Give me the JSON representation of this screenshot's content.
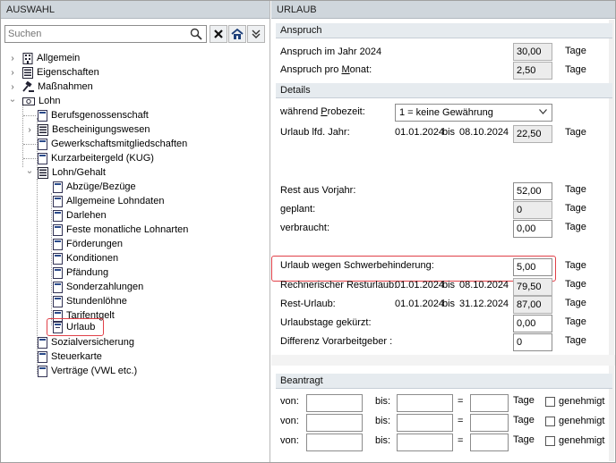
{
  "left": {
    "header": "AUSWAHL",
    "search_placeholder": "Suchen",
    "tree": [
      {
        "label": "Allgemein"
      },
      {
        "label": "Eigenschaften"
      },
      {
        "label": "Maßnahmen"
      },
      {
        "label": "Lohn"
      },
      {
        "label": "Berufsgenossenschaft"
      },
      {
        "label": "Bescheinigungswesen"
      },
      {
        "label": "Gewerkschaftsmitgliedschaften"
      },
      {
        "label": "Kurzarbeitergeld (KUG)"
      },
      {
        "label": "Lohn/Gehalt"
      },
      {
        "label": "Abzüge/Bezüge"
      },
      {
        "label": "Allgemeine Lohndaten"
      },
      {
        "label": "Darlehen"
      },
      {
        "label": "Feste monatliche Lohnarten"
      },
      {
        "label": "Förderungen"
      },
      {
        "label": "Konditionen"
      },
      {
        "label": "Pfändung"
      },
      {
        "label": "Sonderzahlungen"
      },
      {
        "label": "Stundenlöhne"
      },
      {
        "label": "Tarifentgelt"
      },
      {
        "label": "Urlaub"
      },
      {
        "label": "Sozialversicherung"
      },
      {
        "label": "Steuerkarte"
      },
      {
        "label": "Verträge (VWL etc.)"
      }
    ]
  },
  "right": {
    "header": "URLAUB",
    "sections": {
      "anspruch": "Anspruch",
      "details": "Details",
      "beantragt": "Beantragt"
    },
    "anspruch_jahr": {
      "label": "Anspruch im Jahr 2024",
      "value": "30,00",
      "unit": "Tage"
    },
    "anspruch_monat": {
      "label_pre": "Anspruch pro ",
      "label_ul": "M",
      "label_post": "onat:",
      "value": "2,50",
      "unit": "Tage"
    },
    "probezeit": {
      "label_pre": "während ",
      "label_ul": "P",
      "label_post": "robezeit:",
      "value": "1 = keine Gewährung"
    },
    "urlaub_lfd": {
      "label": "Urlaub lfd. Jahr:",
      "from": "01.01.2024",
      "bis": "bis",
      "to": "08.10.2024",
      "value": "22,50",
      "unit": "Tage"
    },
    "rest_vorjahr": {
      "label": "Rest aus Vorjahr:",
      "value": "52,00",
      "unit": "Tage"
    },
    "geplant": {
      "label": "geplant:",
      "value": "0",
      "unit": "Tage"
    },
    "verbraucht": {
      "label": "verbraucht:",
      "value": "0,00",
      "unit": "Tage"
    },
    "schwerbehinderung": {
      "label": "Urlaub wegen Schwerbehinderung:",
      "value": "5,00",
      "unit": "Tage"
    },
    "rechnerisch": {
      "label": "Rechnerischer Resturlaub:",
      "from": "01.01.2024",
      "bis": "bis",
      "to": "08.10.2024",
      "value": "79,50",
      "unit": "Tage"
    },
    "rest_urlaub": {
      "label": "Rest-Urlaub:",
      "from": "01.01.2024",
      "bis": "bis",
      "to": "31.12.2024",
      "value": "87,00",
      "unit": "Tage"
    },
    "gekuerzt": {
      "label": "Urlaubstage gekürzt:",
      "value": "0,00",
      "unit": "Tage"
    },
    "differenz": {
      "label": "Differenz Vorarbeitgeber :",
      "value": "0",
      "unit": "Tage"
    },
    "beantragt_rows": [
      {
        "von": "von:",
        "bis": "bis:",
        "eq": "=",
        "unit": "Tage",
        "check": "genehmigt"
      },
      {
        "von": "von:",
        "bis": "bis:",
        "eq": "=",
        "unit": "Tage",
        "check": "genehmigt"
      },
      {
        "von": "von:",
        "bis": "bis:",
        "eq": "=",
        "unit": "Tage",
        "check": "genehmigt"
      }
    ]
  }
}
